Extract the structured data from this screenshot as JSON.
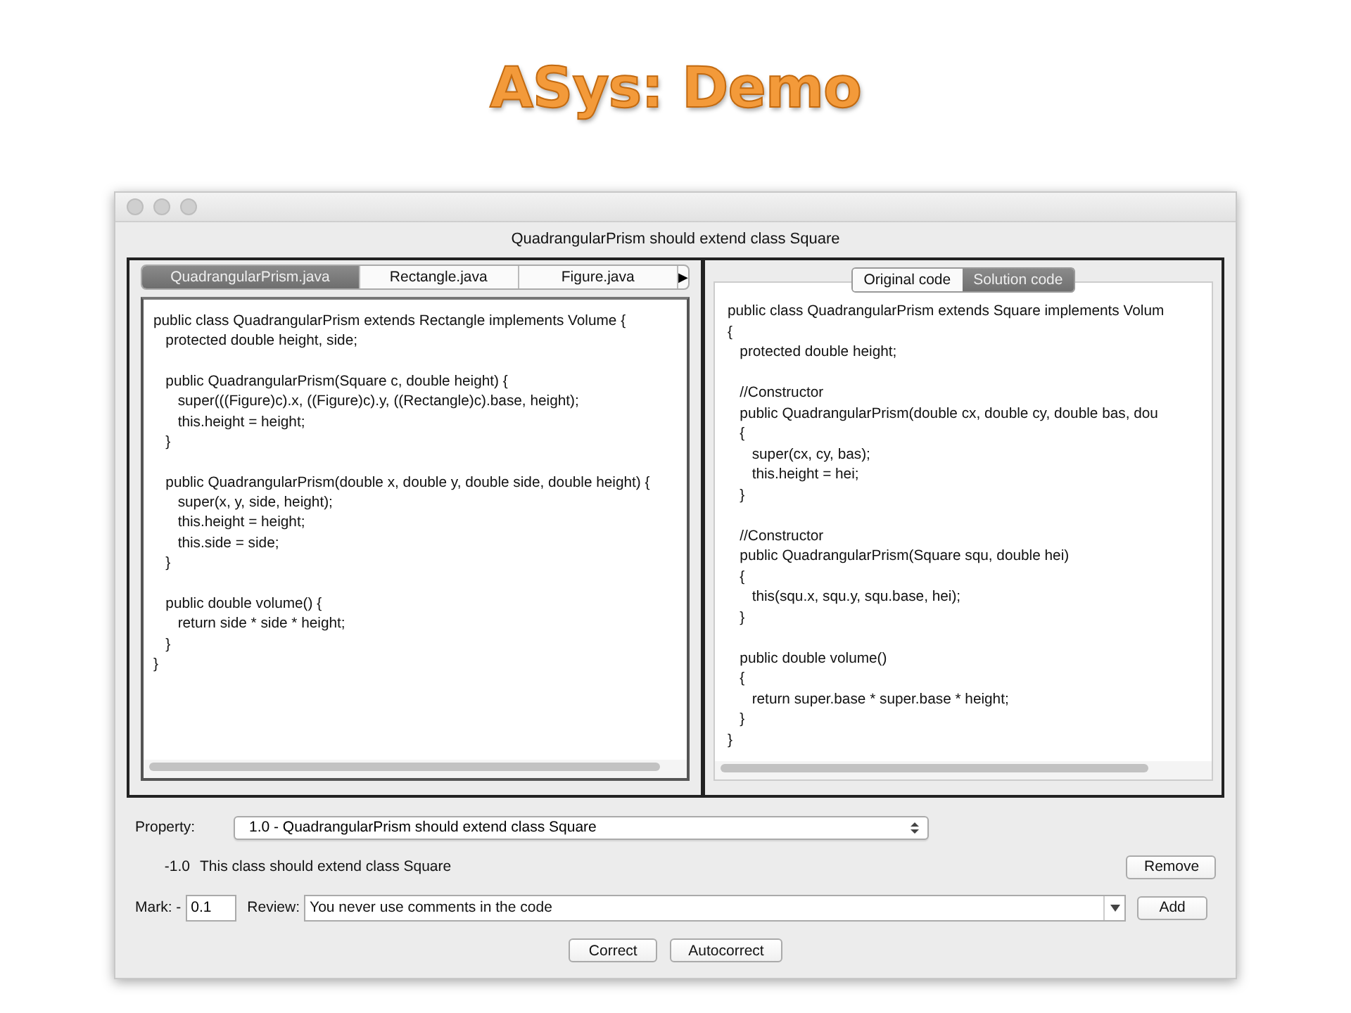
{
  "slide": {
    "title": "ASys: Demo"
  },
  "window": {
    "title": "QuadrangularPrism should extend class Square"
  },
  "file_tabs": [
    {
      "label": "QuadrangularPrism.java",
      "selected": true
    },
    {
      "label": "Rectangle.java",
      "selected": false
    },
    {
      "label": "Figure.java",
      "selected": false
    }
  ],
  "tab_scroll": "▶",
  "left_code": "public class QuadrangularPrism extends Rectangle implements Volume {\n   protected double height, side;\n\n   public QuadrangularPrism(Square c, double height) {\n      super(((Figure)c).x, ((Figure)c).y, ((Rectangle)c).base, height);\n      this.height = height;\n   }\n\n   public QuadrangularPrism(double x, double y, double side, double height) {\n      super(x, y, side, height);\n      this.height = height;\n      this.side = side;\n   }\n\n   public double volume() {\n      return side * side * height;\n   }\n}",
  "code_tabs": [
    {
      "label": "Original code",
      "selected": false
    },
    {
      "label": "Solution code",
      "selected": true
    }
  ],
  "right_code": "public class QuadrangularPrism extends Square implements Volum\n{\n   protected double height;\n\n   //Constructor\n   public QuadrangularPrism(double cx, double cy, double bas, dou\n   {\n      super(cx, cy, bas);\n      this.height = hei;\n   }\n\n   //Constructor\n   public QuadrangularPrism(Square squ, double hei)\n   {\n      this(squ.x, squ.y, squ.base, hei);\n   }\n\n   public double volume()\n   {\n      return super.base * super.base * height;\n   }\n}",
  "property": {
    "label": "Property:",
    "value": "1.0 - QuadrangularPrism should extend class Square"
  },
  "penalty": {
    "mark": "-1.0",
    "text": "This class should extend class Square",
    "button": "Remove"
  },
  "review_row": {
    "mark_label": "Mark: -",
    "mark_value": "0.1",
    "review_label": "Review:",
    "review_value": "You never use comments in the code",
    "button": "Add"
  },
  "buttons": [
    "Correct",
    "Autocorrect"
  ]
}
